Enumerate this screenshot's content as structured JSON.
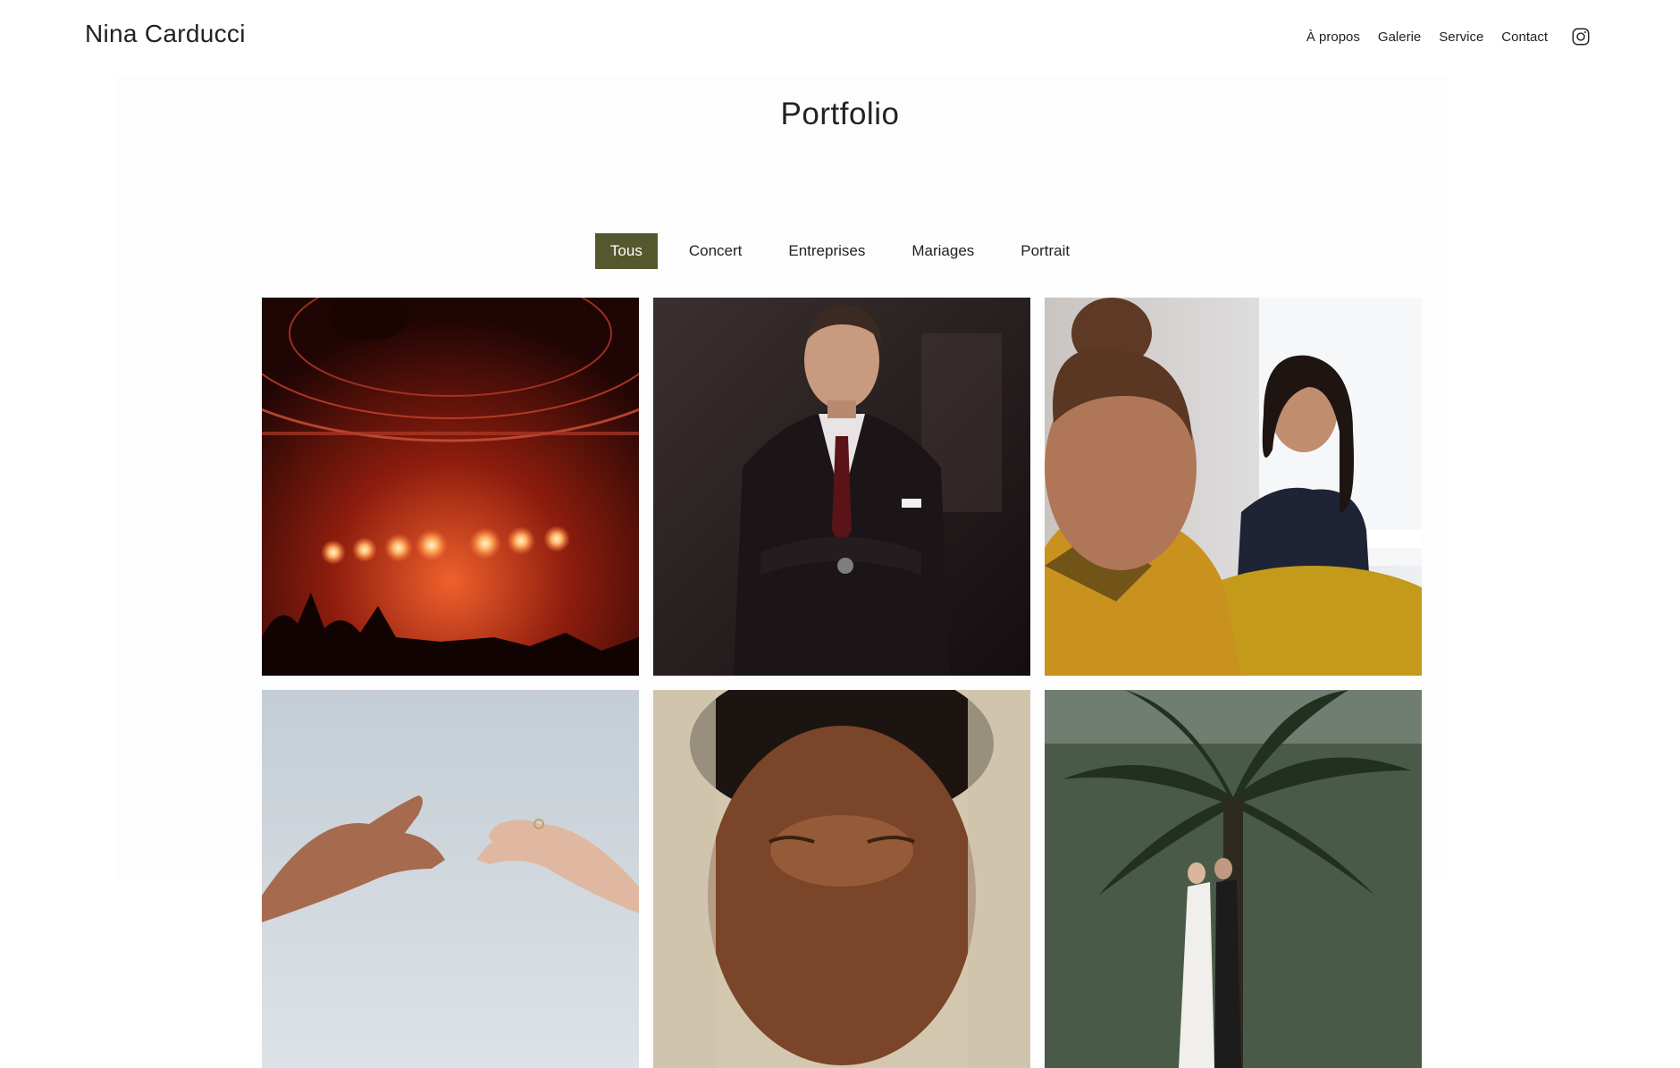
{
  "header": {
    "logo": "Nina Carducci",
    "nav": [
      {
        "label": "À propos"
      },
      {
        "label": "Galerie"
      },
      {
        "label": "Service"
      },
      {
        "label": "Contact"
      }
    ],
    "social_icon": "instagram-icon"
  },
  "main": {
    "title": "Portfolio",
    "filters": [
      {
        "label": "Tous",
        "active": true
      },
      {
        "label": "Concert",
        "active": false
      },
      {
        "label": "Entreprises",
        "active": false
      },
      {
        "label": "Mariages",
        "active": false
      },
      {
        "label": "Portrait",
        "active": false
      }
    ],
    "gallery": [
      {
        "subject": "concert-stage-photo"
      },
      {
        "subject": "businessman-portrait-photo"
      },
      {
        "subject": "office-meeting-photo"
      },
      {
        "subject": "wedding-hands-photo"
      },
      {
        "subject": "man-portrait-closeup-photo"
      },
      {
        "subject": "couple-palm-tree-photo"
      }
    ]
  },
  "colors": {
    "accent": "#55582d",
    "text": "#222222",
    "background": "#ffffff"
  }
}
